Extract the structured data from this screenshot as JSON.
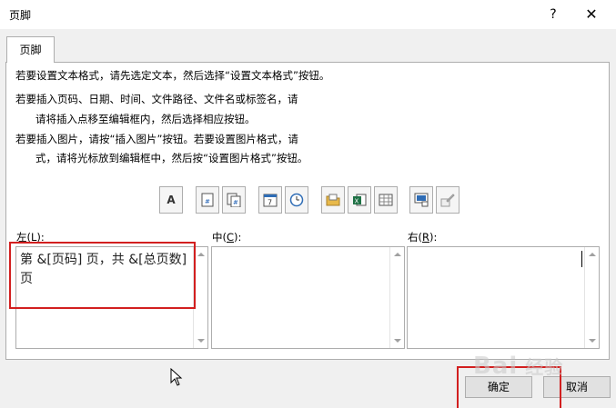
{
  "window": {
    "title": "页脚",
    "help_label": "?",
    "close_label": "✕"
  },
  "tab": {
    "label": "页脚"
  },
  "instructions": {
    "line1": "若要设置文本格式，请先选定文本，然后选择“设置文本格式”按钮。",
    "line2": "若要插入页码、日期、时间、文件路径、文件名或标签名，请",
    "line3": "请将插入点移至编辑框内，然后选择相应按钮。",
    "line4": "若要插入图片，请按“插入图片”按钮。若要设置图片格式，请",
    "line5": "式，请将光标放到编辑框中，然后按“设置图片格式”按钮。"
  },
  "toolbar": [
    {
      "name": "format-text-icon",
      "glyph": "A"
    },
    {
      "name": "insert-page-number-icon"
    },
    {
      "name": "insert-page-count-icon"
    },
    {
      "name": "insert-date-icon",
      "glyph": "7"
    },
    {
      "name": "insert-time-icon"
    },
    {
      "name": "insert-file-path-icon"
    },
    {
      "name": "insert-file-name-icon"
    },
    {
      "name": "insert-sheet-name-icon"
    },
    {
      "name": "insert-picture-icon"
    },
    {
      "name": "format-picture-icon"
    }
  ],
  "sections": {
    "left": {
      "label_main": "左(",
      "label_key": "L",
      "label_end": "):",
      "value": "第 &[页码] 页，共 &[总页数] 页"
    },
    "center": {
      "label_main": "中(",
      "label_key": "C",
      "label_end": "):",
      "value": ""
    },
    "right": {
      "label_main": "右(",
      "label_key": "R",
      "label_end": "):",
      "value": ""
    }
  },
  "buttons": {
    "ok_label": "确定",
    "cancel_label": "取消"
  },
  "watermark": {
    "text": "Bai 经验"
  },
  "colors": {
    "highlight": "#d21f1f"
  }
}
